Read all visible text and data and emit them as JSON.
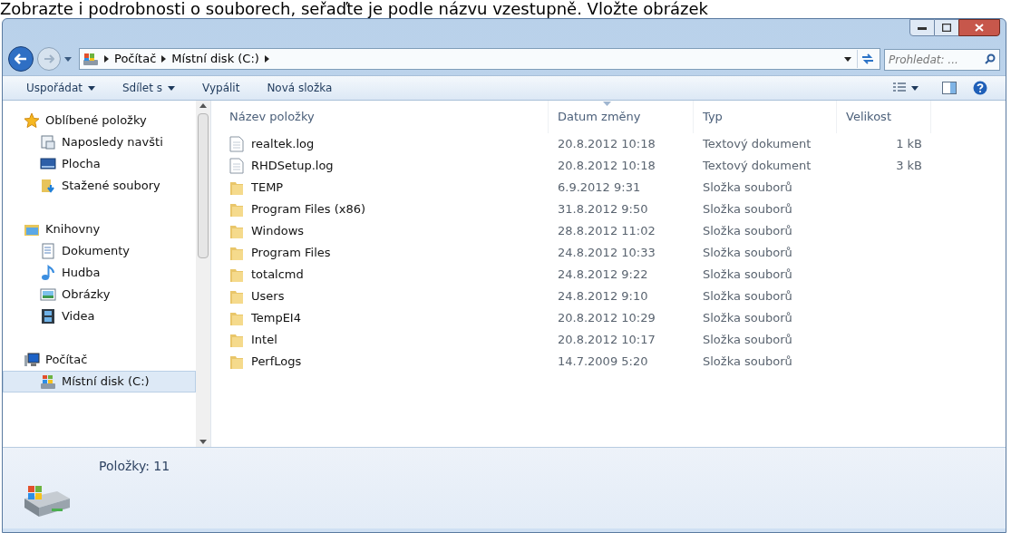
{
  "instruction": "Zobrazte i podrobnosti o souborech, seřaďte je podle názvu vzestupně. Vložte obrázek",
  "address": {
    "crumbs": [
      "Počítač",
      "Místní disk (C:)"
    ]
  },
  "search": {
    "placeholder": "Prohledat: ..."
  },
  "toolbar": {
    "buttons": [
      {
        "label": "Uspořádat",
        "dropdown": true
      },
      {
        "label": "Sdílet s",
        "dropdown": true
      },
      {
        "label": "Vypálit",
        "dropdown": false
      },
      {
        "label": "Nová složka",
        "dropdown": false
      }
    ]
  },
  "sidebar": {
    "groups": [
      {
        "label": "Oblíbené položky",
        "kind": "favorites",
        "selected": false,
        "items": [
          {
            "label": "Naposledy navšti",
            "kind": "recent",
            "selected": false
          },
          {
            "label": "Plocha",
            "kind": "desktop",
            "selected": false
          },
          {
            "label": "Stažené soubory",
            "kind": "downloads",
            "selected": false
          }
        ]
      },
      {
        "label": "Knihovny",
        "kind": "libraries",
        "selected": false,
        "items": [
          {
            "label": "Dokumenty",
            "kind": "documents",
            "selected": false
          },
          {
            "label": "Hudba",
            "kind": "music",
            "selected": false
          },
          {
            "label": "Obrázky",
            "kind": "pictures",
            "selected": false
          },
          {
            "label": "Videa",
            "kind": "videos",
            "selected": false
          }
        ]
      },
      {
        "label": "Počítač",
        "kind": "computer",
        "selected": false,
        "items": [
          {
            "label": "Místní disk (C:)",
            "kind": "drive",
            "selected": true
          }
        ]
      }
    ]
  },
  "table": {
    "columns": [
      {
        "label": "Název položky",
        "sorted": false
      },
      {
        "label": "Datum změny",
        "sorted": true
      },
      {
        "label": "Typ",
        "sorted": false
      },
      {
        "label": "Velikost",
        "sorted": false
      }
    ],
    "rows": [
      {
        "kind": "file",
        "name": "realtek.log",
        "date": "20.8.2012 10:18",
        "type": "Textový dokument",
        "size": "1 kB"
      },
      {
        "kind": "file",
        "name": "RHDSetup.log",
        "date": "20.8.2012 10:18",
        "type": "Textový dokument",
        "size": "3 kB"
      },
      {
        "kind": "folder",
        "name": "TEMP",
        "date": "6.9.2012 9:31",
        "type": "Složka souborů"
      },
      {
        "kind": "folder",
        "name": "Program Files (x86)",
        "date": "31.8.2012 9:50",
        "type": "Složka souborů"
      },
      {
        "kind": "folder",
        "name": "Windows",
        "date": "28.8.2012 11:02",
        "type": "Složka souborů"
      },
      {
        "kind": "folder",
        "name": "Program Files",
        "date": "24.8.2012 10:33",
        "type": "Složka souborů"
      },
      {
        "kind": "folder",
        "name": "totalcmd",
        "date": "24.8.2012 9:22",
        "type": "Složka souborů"
      },
      {
        "kind": "folder",
        "name": "Users",
        "date": "24.8.2012 9:10",
        "type": "Složka souborů"
      },
      {
        "kind": "folder",
        "name": "TempEI4",
        "date": "20.8.2012 10:29",
        "type": "Složka souborů"
      },
      {
        "kind": "folder",
        "name": "Intel",
        "date": "20.8.2012 10:17",
        "type": "Složka souborů"
      },
      {
        "kind": "folder",
        "name": "PerfLogs",
        "date": "14.7.2009 5:20",
        "type": "Složka souborů"
      }
    ]
  },
  "status_bar": {
    "text": "Položky: 11"
  }
}
